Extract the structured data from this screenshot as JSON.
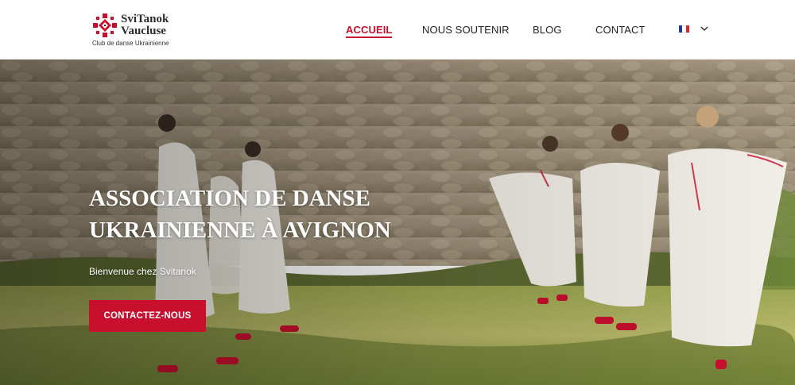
{
  "brand": {
    "title": "SviTanok\nVaucluse",
    "subtitle": "Club de danse Ukrainienne",
    "emblem_icon": "ukrainian-ornament-icon",
    "accent": "#c8102e"
  },
  "nav": {
    "items": [
      {
        "label": "ACCUEIL",
        "active": true
      },
      {
        "label": "NOUS SOUTENIR",
        "active": false
      },
      {
        "label": "BLOG",
        "active": false
      },
      {
        "label": "CONTACT",
        "active": false
      }
    ],
    "language": {
      "icon": "french-flag-icon",
      "dropdown_icon": "chevron-down-icon"
    }
  },
  "hero": {
    "title": "ASSOCIATION DE DANSE UKRAINIENNE À AVIGNON",
    "subtitle": "Bienvenue chez Svitanok",
    "cta_label": "CONTACTEZ-NOUS",
    "cta_color": "#c8102e"
  }
}
